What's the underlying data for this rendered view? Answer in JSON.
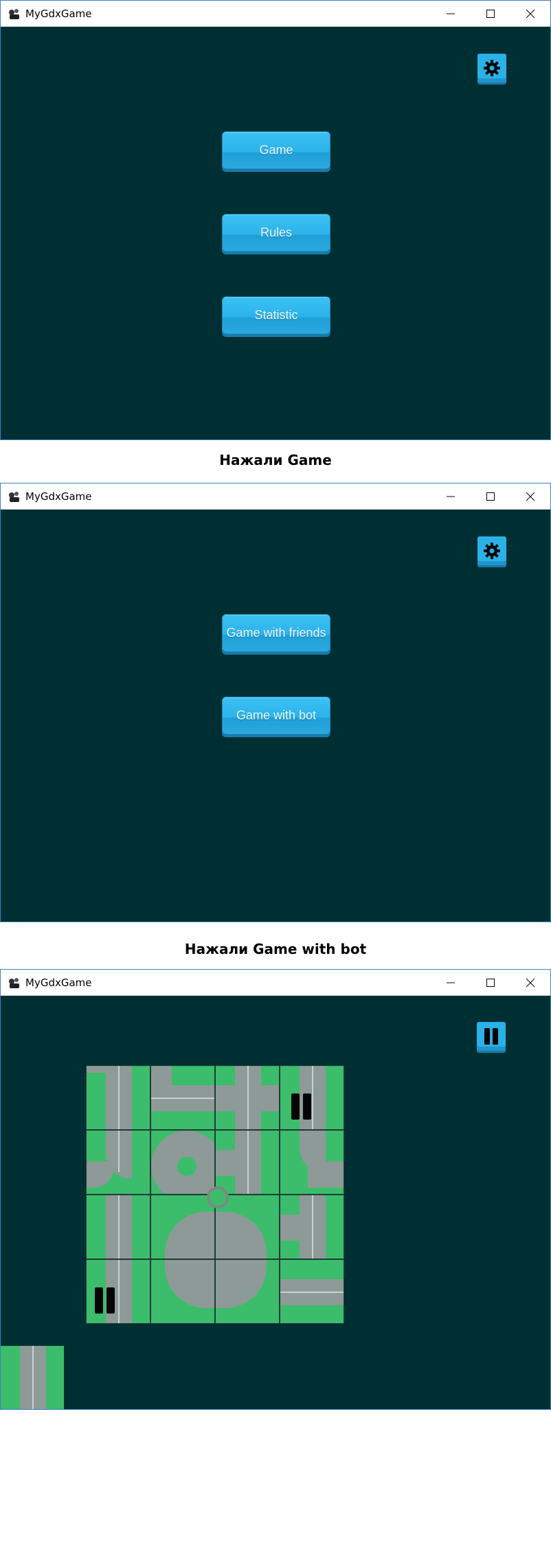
{
  "windows": [
    {
      "title": "MyGdxGame",
      "buttons": [
        "Game",
        "Rules",
        "Statistic"
      ]
    },
    {
      "title": "MyGdxGame",
      "buttons": [
        "Game with friends",
        "Game with bot"
      ]
    },
    {
      "title": "MyGdxGame"
    }
  ],
  "captions": [
    "Нажали Game",
    "Нажали Game with bot"
  ],
  "icons": {
    "app": "app-icon",
    "minimize": "minimize-icon",
    "maximize": "maximize-icon",
    "close": "close-icon",
    "settings": "gear-icon",
    "pause": "pause-icon"
  },
  "colors": {
    "background": "#002f33",
    "button": "#29b1e8",
    "tile_grass": "#3bbd6b",
    "road": "#8e9a98"
  }
}
